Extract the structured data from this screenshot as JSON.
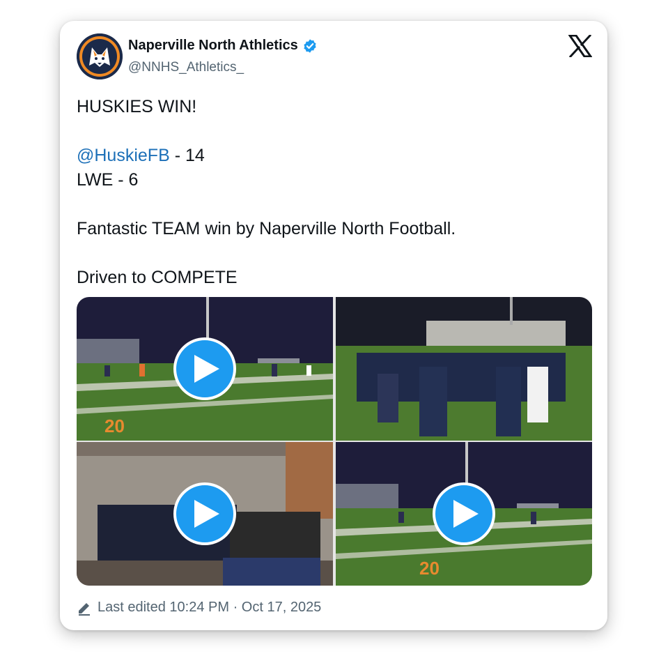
{
  "account": {
    "display_name": "Naperville North Athletics",
    "handle": "@NNHS_Athletics_",
    "verified": true,
    "avatar_icon": "husky-logo"
  },
  "brand_icon": "x-logo-icon",
  "tweet": {
    "line1": "HUSKIES WIN!",
    "mention": "@HuskieFB",
    "line2_rest": " - 14",
    "line3": "LWE - 6",
    "line4": "Fantastic TEAM win by Naperville North Football.",
    "line5": "Driven to COMPETE"
  },
  "media": [
    {
      "type": "video",
      "icon": "play-icon"
    },
    {
      "type": "video",
      "icon": "play-icon"
    },
    {
      "type": "video",
      "icon": "play-icon"
    },
    {
      "type": "video",
      "icon": "play-icon"
    }
  ],
  "footer": {
    "icon": "pencil-icon",
    "text": "Last edited 10:24 PM · Oct 17, 2025"
  },
  "colors": {
    "link": "#1d70b8",
    "play_button": "#1d9bf0",
    "verified": "#1d9bf0",
    "secondary_text": "#536471"
  }
}
